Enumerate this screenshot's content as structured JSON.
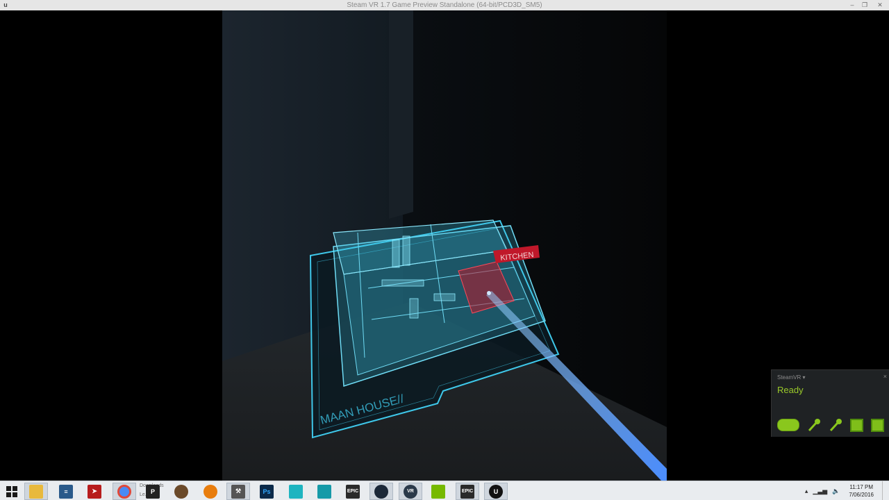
{
  "window": {
    "title": "Steam VR 1.7 Game Preview Standalone (64-bit/PCD3D_SM5)",
    "icon": "unreal-u-icon",
    "controls": [
      "minimize-icon",
      "restore-icon",
      "close-icon"
    ]
  },
  "scene": {
    "map_label": "MAAN HOUSE//",
    "room_tag": "KITCHEN",
    "colors": {
      "hologram": "#3fc8ea",
      "tag": "#c0182a",
      "laser": "#5aa8ff"
    }
  },
  "steamvr": {
    "title": "SteamVR ▾",
    "status": "Ready",
    "close": "×",
    "devices": [
      "headset-icon",
      "controller-icon",
      "controller-icon",
      "base-station-icon",
      "base-station-icon"
    ],
    "status_color": "#9ac92a"
  },
  "taskbar": {
    "pinned": [
      {
        "name": "start-button",
        "icon": "windows-logo-icon"
      },
      {
        "name": "file-explorer",
        "icon": "folder-icon"
      },
      {
        "name": "notepad",
        "icon": "notepad-icon"
      },
      {
        "name": "app-bird",
        "icon": "bird-icon"
      },
      {
        "name": "chrome",
        "icon": "chrome-icon"
      },
      {
        "name": "app-p",
        "icon": "p-icon",
        "text": "P"
      },
      {
        "name": "app-shield",
        "icon": "shield-icon"
      },
      {
        "name": "blender",
        "icon": "blender-icon"
      },
      {
        "name": "app-tool",
        "icon": "tool-icon"
      },
      {
        "name": "photoshop",
        "icon": "photoshop-icon",
        "text": "Ps"
      },
      {
        "name": "maya-1",
        "icon": "maya-icon"
      },
      {
        "name": "maya-2",
        "icon": "maya-icon"
      },
      {
        "name": "epic-launcher-1",
        "icon": "epic-icon",
        "text": "EPIC"
      },
      {
        "name": "steam",
        "icon": "steam-icon"
      },
      {
        "name": "steamvr",
        "icon": "vr-icon",
        "text": "VR"
      },
      {
        "name": "nvidia",
        "icon": "nvidia-icon"
      },
      {
        "name": "epic-launcher-2",
        "icon": "epic-icon",
        "text": "EPIC"
      },
      {
        "name": "unreal-editor",
        "icon": "unreal-icon",
        "text": "U"
      }
    ],
    "chrome_label_1": "Downloads",
    "chrome_label_2": "Le...ve",
    "tray": {
      "icons": [
        "tray-expand-icon",
        "network-icon",
        "volume-icon"
      ],
      "expand": "▴",
      "time": "11:17 PM",
      "date": "7/06/2016"
    }
  }
}
